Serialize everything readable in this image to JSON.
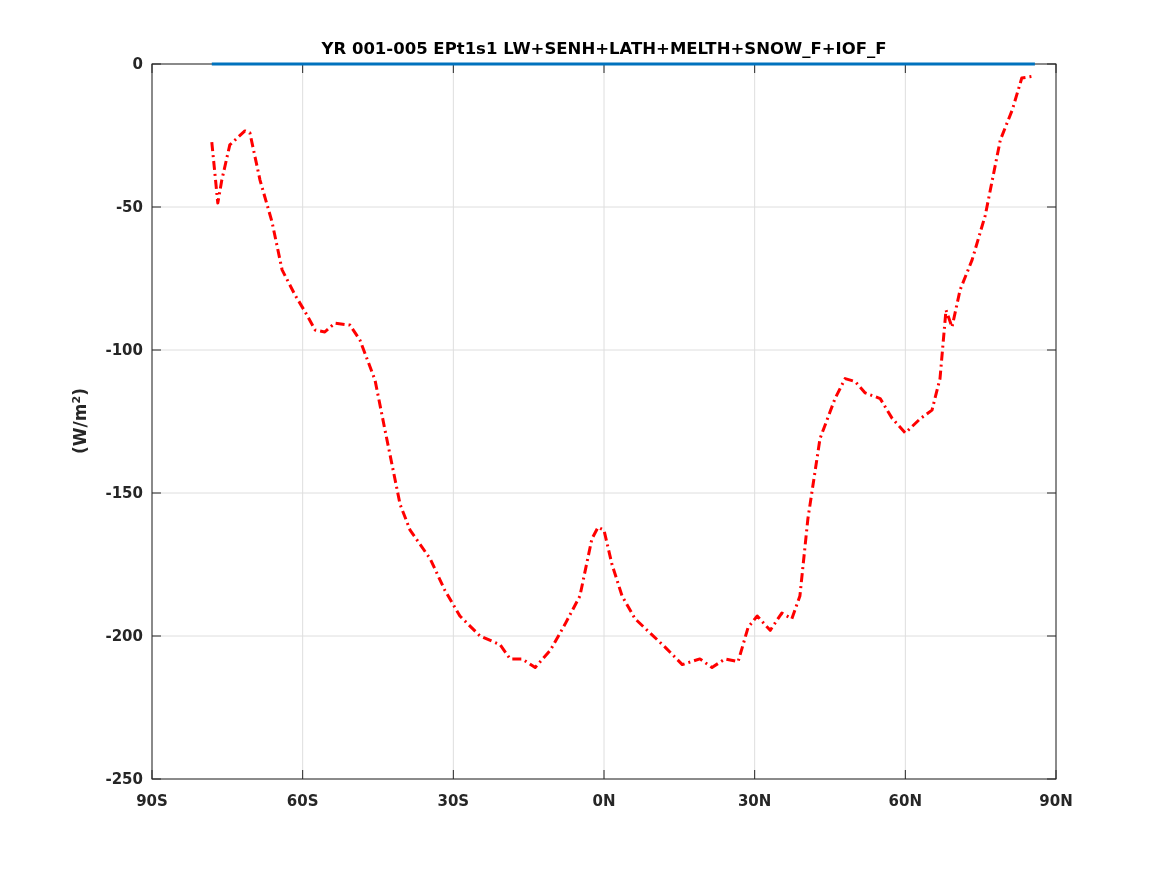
{
  "figure": {
    "chart_data": {
      "type": "line",
      "title": "YR 001-005 EPt1s1 LW+SENH+LATH+MELTH+SNOW_F+IOF_F",
      "ylabel": "(W/m$^{2}$)",
      "x": [
        -78.1,
        -76.9,
        -76.1,
        -74.5,
        -71.5,
        -70.5,
        -68.5,
        -66.1,
        -64.1,
        -61.5,
        -59.5,
        -57.5,
        -55.6,
        -53.6,
        -50.6,
        -48.6,
        -45.6,
        -43.6,
        -40.6,
        -38.6,
        -34.6,
        -31.7,
        -28.7,
        -24.7,
        -20.7,
        -18.7,
        -16.3,
        -13.7,
        -10.7,
        -7.8,
        -4.8,
        -2.4,
        -1.2,
        0,
        1.6,
        3.6,
        6.2,
        9.2,
        12.2,
        15.6,
        19.1,
        21.5,
        24.1,
        26.7,
        28.7,
        30.5,
        33.1,
        35.4,
        37.4,
        39,
        40.6,
        43,
        46,
        48,
        50,
        52,
        55,
        57.4,
        60,
        63,
        65.3,
        66.9,
        68.1,
        69.3,
        70.9,
        73.3,
        75.9,
        78.9,
        81.3,
        83.2,
        85.8
      ],
      "series": [
        {
          "color": "#0072bd",
          "line_style": "solid",
          "values": [
            0,
            0,
            0,
            0,
            0,
            0,
            0,
            0,
            0,
            0,
            0,
            0,
            0,
            0,
            0,
            0,
            0,
            0,
            0,
            0,
            0,
            0,
            0,
            0,
            0,
            0,
            0,
            0,
            0,
            0,
            0,
            0,
            0,
            0,
            0,
            0,
            0,
            0,
            0,
            0,
            0,
            0,
            0,
            0,
            0,
            0,
            0,
            0,
            0,
            0,
            0,
            0,
            0,
            0,
            0,
            0,
            0,
            0,
            0,
            0,
            0,
            0,
            0,
            0,
            0,
            0,
            0,
            0,
            0,
            0,
            0
          ]
        },
        {
          "color": "#ff0000",
          "line_style": "dashdot",
          "values": [
            -27.3,
            -48.6,
            -40.6,
            -28.3,
            -23.4,
            -24.1,
            -40.6,
            -55.2,
            -72,
            -80.8,
            -86.7,
            -93,
            -93.7,
            -90.6,
            -91.3,
            -96.5,
            -110.5,
            -128,
            -154,
            -163,
            -173,
            -184,
            -193,
            -200,
            -203,
            -208,
            -208,
            -211,
            -205,
            -196,
            -186,
            -166,
            -162,
            -163,
            -175,
            -186,
            -194,
            -199,
            -204,
            -210,
            -208,
            -211,
            -208,
            -209,
            -197,
            -193,
            -198,
            -192,
            -194,
            -186,
            -159,
            -131,
            -117,
            -110,
            -111,
            -115,
            -117,
            -124,
            -129,
            -124,
            -121,
            -110,
            -86,
            -92,
            -79,
            -68.5,
            -53,
            -26.6,
            -16,
            -4.9,
            -4.2
          ]
        }
      ],
      "grid": true,
      "xlim": [
        -90,
        90
      ],
      "ylim": [
        -250,
        0
      ],
      "xticks": [
        {
          "value": -90,
          "label": "90S"
        },
        {
          "value": -60,
          "label": "60S"
        },
        {
          "value": -30,
          "label": "30S"
        },
        {
          "value": 0,
          "label": "0N"
        },
        {
          "value": 30,
          "label": "30N"
        },
        {
          "value": 60,
          "label": "60N"
        },
        {
          "value": 90,
          "label": "90N"
        }
      ],
      "yticks": [
        0,
        -50,
        -100,
        -150,
        -200,
        -250
      ]
    }
  }
}
